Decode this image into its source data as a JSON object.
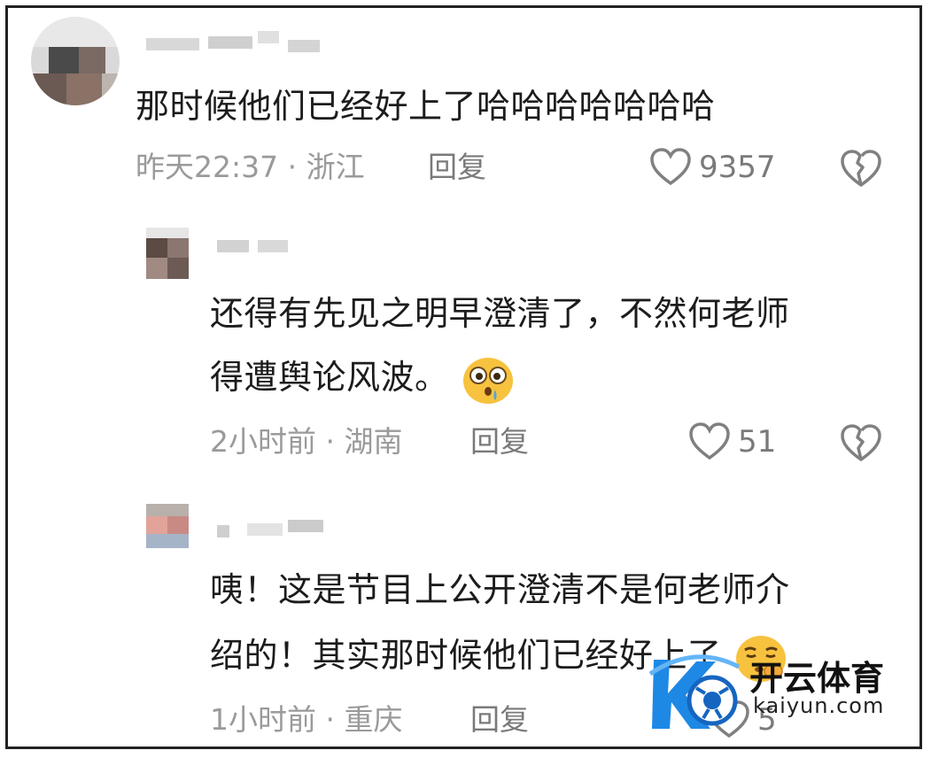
{
  "comments": [
    {
      "text_line1": "那时候他们已经好上了哈哈哈哈哈哈哈",
      "time": "昨天22:37 · 浙江",
      "reply_label": "回复",
      "likes": "9357"
    },
    {
      "text_line1": "还得有先见之明早澄清了，不然何老师",
      "text_line2": "得遭舆论风波。",
      "time": "2小时前 · 湖南",
      "reply_label": "回复",
      "likes": "51"
    },
    {
      "text_line1": "咦！这是节目上公开澄清不是何老师介",
      "text_line2": "绍的！其实那时候他们已经好上了",
      "time": "1小时前 · 重庆",
      "reply_label": "回复",
      "likes": "5"
    }
  ],
  "watermark": {
    "title": "开云体育",
    "url": "kaiyun.com"
  },
  "colors": {
    "text": "#1c1c1c",
    "meta": "#9a9a9a",
    "icon": "#808080",
    "brand_blue": "#1e88e5"
  }
}
